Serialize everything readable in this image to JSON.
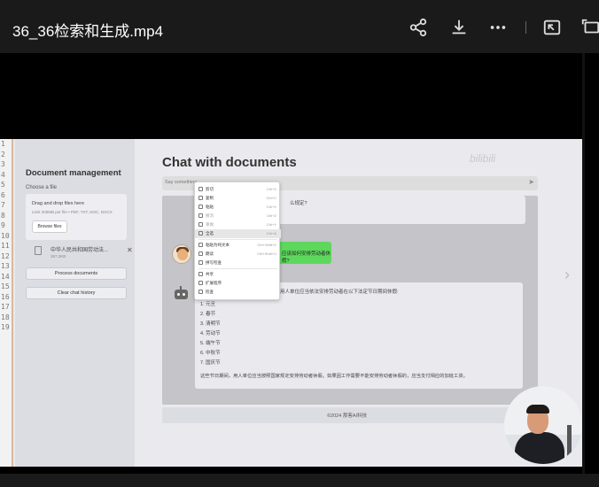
{
  "player": {
    "title": "36_36检索和生成.mp4",
    "icons": [
      "share-icon",
      "download-icon",
      "more-icon",
      "pip-icon",
      "fullscreen-icon"
    ]
  },
  "gutter": [
    "1",
    "2",
    "3",
    "4",
    "5",
    "6",
    "7",
    "8",
    "9",
    "10",
    "11",
    "12",
    "13",
    "14",
    "15",
    "16",
    "17",
    "18",
    "19"
  ],
  "sidebar": {
    "title": "Document management",
    "choose_label": "Choose a file",
    "dropzone_line1": "Drag and drop files here",
    "dropzone_line2": "Limit 200MB per file • PDF, TXT, DOC, DOCX",
    "browse_label": "Browse files",
    "file_name": "中华人民共和国劳动法...",
    "file_size": "267.2KB",
    "process_label": "Process documents",
    "clear_label": "Clear chat history"
  },
  "main": {
    "title": "Chat with documents",
    "watermark": "bilibili",
    "input_placeholder": "Say something",
    "bubble1_text": "么规定?",
    "user_question": "应该如何安排劳动者休假?",
    "answer_intro": "用人单位应当依法安排劳动者在以下法定节日期间休假:",
    "holidays": [
      "1. 元旦",
      "2. 春节",
      "3. 清明节",
      "4. 劳动节",
      "5. 端午节",
      "6. 中秋节",
      "7. 国庆节"
    ],
    "answer_footer": "这些节日期间，用人单位应当按照国家规定安排劳动者休假。如果因工作需要不能安排劳动者休假的，应当支付相应的加班工资。",
    "footer": "©2024 那客AI科技"
  },
  "context_menu": [
    {
      "label": "剪切",
      "shortcut": "Ctrl+X",
      "dim": false
    },
    {
      "label": "复制",
      "shortcut": "Ctrl+C",
      "dim": false
    },
    {
      "label": "粘贴",
      "shortcut": "Ctrl+V",
      "dim": false
    },
    {
      "label": "撤消",
      "shortcut": "Ctrl+Z",
      "dim": true
    },
    {
      "label": "重做",
      "shortcut": "Ctrl+Y",
      "dim": true
    },
    {
      "label": "全选",
      "shortcut": "Ctrl+A",
      "dim": false
    },
    {
      "label": "粘贴为纯文本",
      "shortcut": "Ctrl+Shift+V",
      "dim": false
    },
    {
      "label": "朗读",
      "shortcut": "Ctrl+Shift+U",
      "dim": false
    },
    {
      "label": "拼写检查",
      "shortcut": "",
      "dim": false
    },
    {
      "label": "共享",
      "shortcut": "",
      "dim": false
    },
    {
      "label": "扩展程序",
      "shortcut": "",
      "dim": false
    },
    {
      "label": "检查",
      "shortcut": "",
      "dim": false
    }
  ]
}
